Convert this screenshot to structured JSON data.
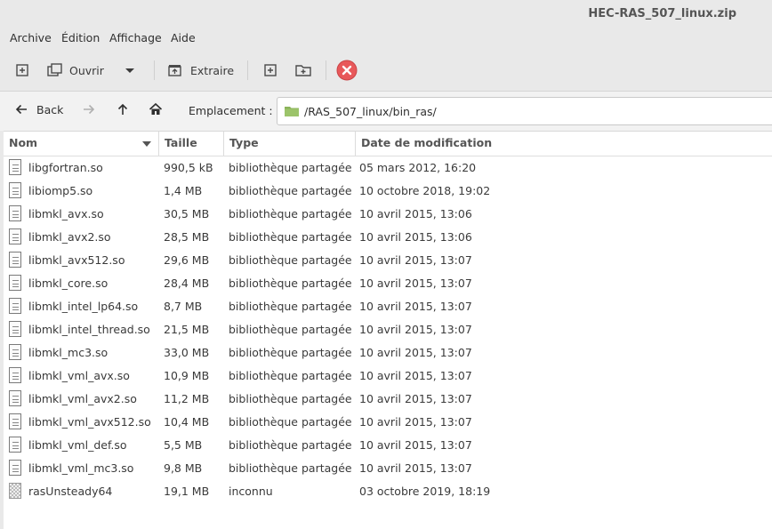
{
  "window": {
    "title": "HEC-RAS_507_linux.zip"
  },
  "menu": {
    "archive": "Archive",
    "edition": "Édition",
    "affichage": "Affichage",
    "aide": "Aide"
  },
  "toolbar": {
    "open_label": "Ouvrir",
    "extract_label": "Extraire"
  },
  "location": {
    "back_label": "Back",
    "label": "Emplacement :",
    "path": "/RAS_507_linux/bin_ras/"
  },
  "columns": {
    "name": "Nom",
    "size": "Taille",
    "type": "Type",
    "modified": "Date de modification"
  },
  "files": [
    {
      "name": "libgfortran.so",
      "size": "990,5 kB",
      "type": "bibliothèque partagée",
      "modified": "05 mars 2012, 16:20",
      "icon": "library-file-icon"
    },
    {
      "name": "libiomp5.so",
      "size": "1,4 MB",
      "type": "bibliothèque partagée",
      "modified": "10 octobre 2018, 19:02",
      "icon": "library-file-icon"
    },
    {
      "name": "libmkl_avx.so",
      "size": "30,5 MB",
      "type": "bibliothèque partagée",
      "modified": "10 avril 2015, 13:06",
      "icon": "library-file-icon"
    },
    {
      "name": "libmkl_avx2.so",
      "size": "28,5 MB",
      "type": "bibliothèque partagée",
      "modified": "10 avril 2015, 13:06",
      "icon": "library-file-icon"
    },
    {
      "name": "libmkl_avx512.so",
      "size": "29,6 MB",
      "type": "bibliothèque partagée",
      "modified": "10 avril 2015, 13:07",
      "icon": "library-file-icon"
    },
    {
      "name": "libmkl_core.so",
      "size": "28,4 MB",
      "type": "bibliothèque partagée",
      "modified": "10 avril 2015, 13:07",
      "icon": "library-file-icon"
    },
    {
      "name": "libmkl_intel_lp64.so",
      "size": "8,7 MB",
      "type": "bibliothèque partagée",
      "modified": "10 avril 2015, 13:07",
      "icon": "library-file-icon"
    },
    {
      "name": "libmkl_intel_thread.so",
      "size": "21,5 MB",
      "type": "bibliothèque partagée",
      "modified": "10 avril 2015, 13:07",
      "icon": "library-file-icon"
    },
    {
      "name": "libmkl_mc3.so",
      "size": "33,0 MB",
      "type": "bibliothèque partagée",
      "modified": "10 avril 2015, 13:07",
      "icon": "library-file-icon"
    },
    {
      "name": "libmkl_vml_avx.so",
      "size": "10,9 MB",
      "type": "bibliothèque partagée",
      "modified": "10 avril 2015, 13:07",
      "icon": "library-file-icon"
    },
    {
      "name": "libmkl_vml_avx2.so",
      "size": "11,2 MB",
      "type": "bibliothèque partagée",
      "modified": "10 avril 2015, 13:07",
      "icon": "library-file-icon"
    },
    {
      "name": "libmkl_vml_avx512.so",
      "size": "10,4 MB",
      "type": "bibliothèque partagée",
      "modified": "10 avril 2015, 13:07",
      "icon": "library-file-icon"
    },
    {
      "name": "libmkl_vml_def.so",
      "size": "5,5 MB",
      "type": "bibliothèque partagée",
      "modified": "10 avril 2015, 13:07",
      "icon": "library-file-icon"
    },
    {
      "name": "libmkl_vml_mc3.so",
      "size": "9,8 MB",
      "type": "bibliothèque partagée",
      "modified": "10 avril 2015, 13:07",
      "icon": "library-file-icon"
    },
    {
      "name": "rasUnsteady64",
      "size": "19,1 MB",
      "type": "inconnu",
      "modified": "03 octobre 2019, 18:19",
      "icon": "unknown-file-icon"
    }
  ],
  "colors": {
    "stop_button": "#e8585a",
    "folder": "#8bb35a",
    "chrome_bg": "#e9e9e9"
  }
}
